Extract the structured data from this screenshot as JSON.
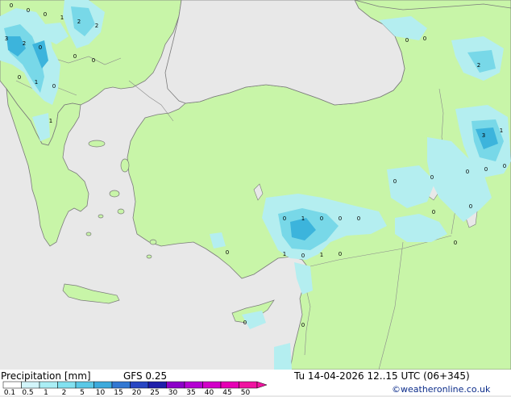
{
  "map": {
    "colors": {
      "sea": "#e8e8e8",
      "land": "#c8f5a8",
      "coast": "#7a7a7a",
      "precip_light": "#b4eef0",
      "precip_mid": "#78d8e8",
      "precip_high": "#3cb4dc"
    },
    "labels": [
      "0",
      "0",
      "0",
      "1",
      "2",
      "2",
      "3",
      "2",
      "0",
      "0",
      "0",
      "0",
      "1",
      "0",
      "1",
      "0",
      "0",
      "2",
      "3",
      "1",
      "0",
      "0",
      "0",
      "0",
      "0",
      "1",
      "0",
      "0",
      "0",
      "0",
      "1",
      "0",
      "1",
      "0",
      "0",
      "0",
      "0"
    ]
  },
  "footer": {
    "title": "Precipitation [mm]",
    "model": "GFS 0.25",
    "datetime": "Tu 14-04-2026 12..15 UTC (06+345)",
    "credit": "©weatheronline.co.uk",
    "scale_labels": [
      "0.1",
      "0.5",
      "1",
      "2",
      "5",
      "10",
      "15",
      "20",
      "25",
      "30",
      "35",
      "40",
      "45",
      "50"
    ],
    "scale_colors": [
      "#ffffff",
      "#d2f5fa",
      "#aaeef5",
      "#82e1f0",
      "#5ac8e6",
      "#3caadc",
      "#3278d2",
      "#2846c3",
      "#1e1eaa",
      "#8c00c8",
      "#b400d2",
      "#d200c8",
      "#e600b4",
      "#f014a0"
    ]
  }
}
